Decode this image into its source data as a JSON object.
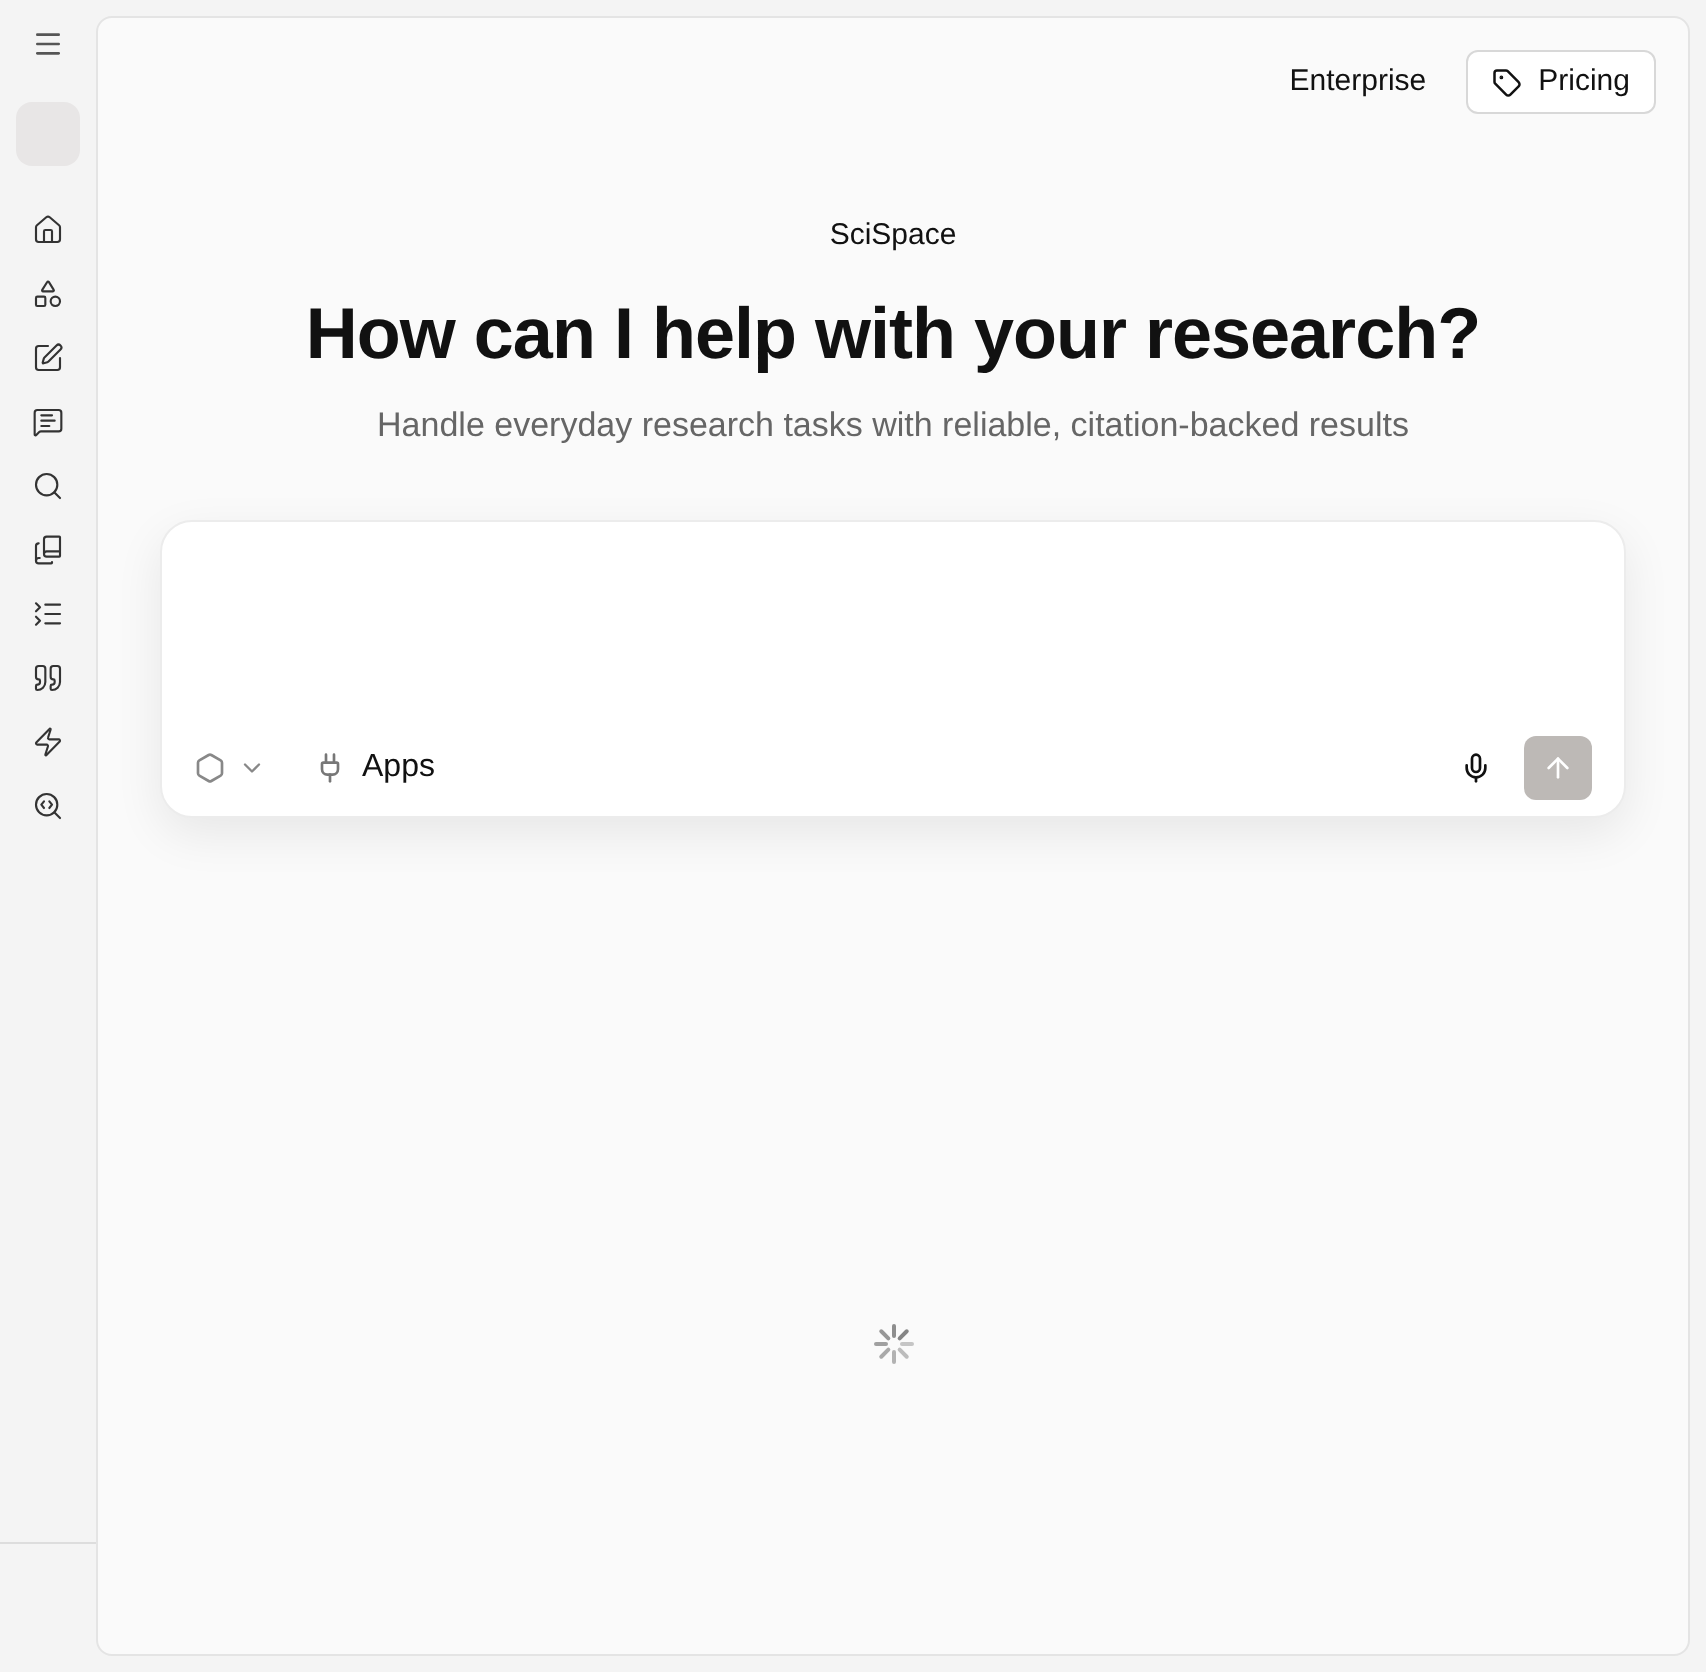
{
  "header": {
    "links": [
      "Enterprise"
    ],
    "pricing_button": "Pricing"
  },
  "hero": {
    "brand": "SciSpace",
    "title": "How can I help with your research?",
    "subtitle": "Handle everyday research tasks with reliable, citation-backed results"
  },
  "composer": {
    "apps_button": "Apps",
    "send_disabled": true
  },
  "loading": true
}
